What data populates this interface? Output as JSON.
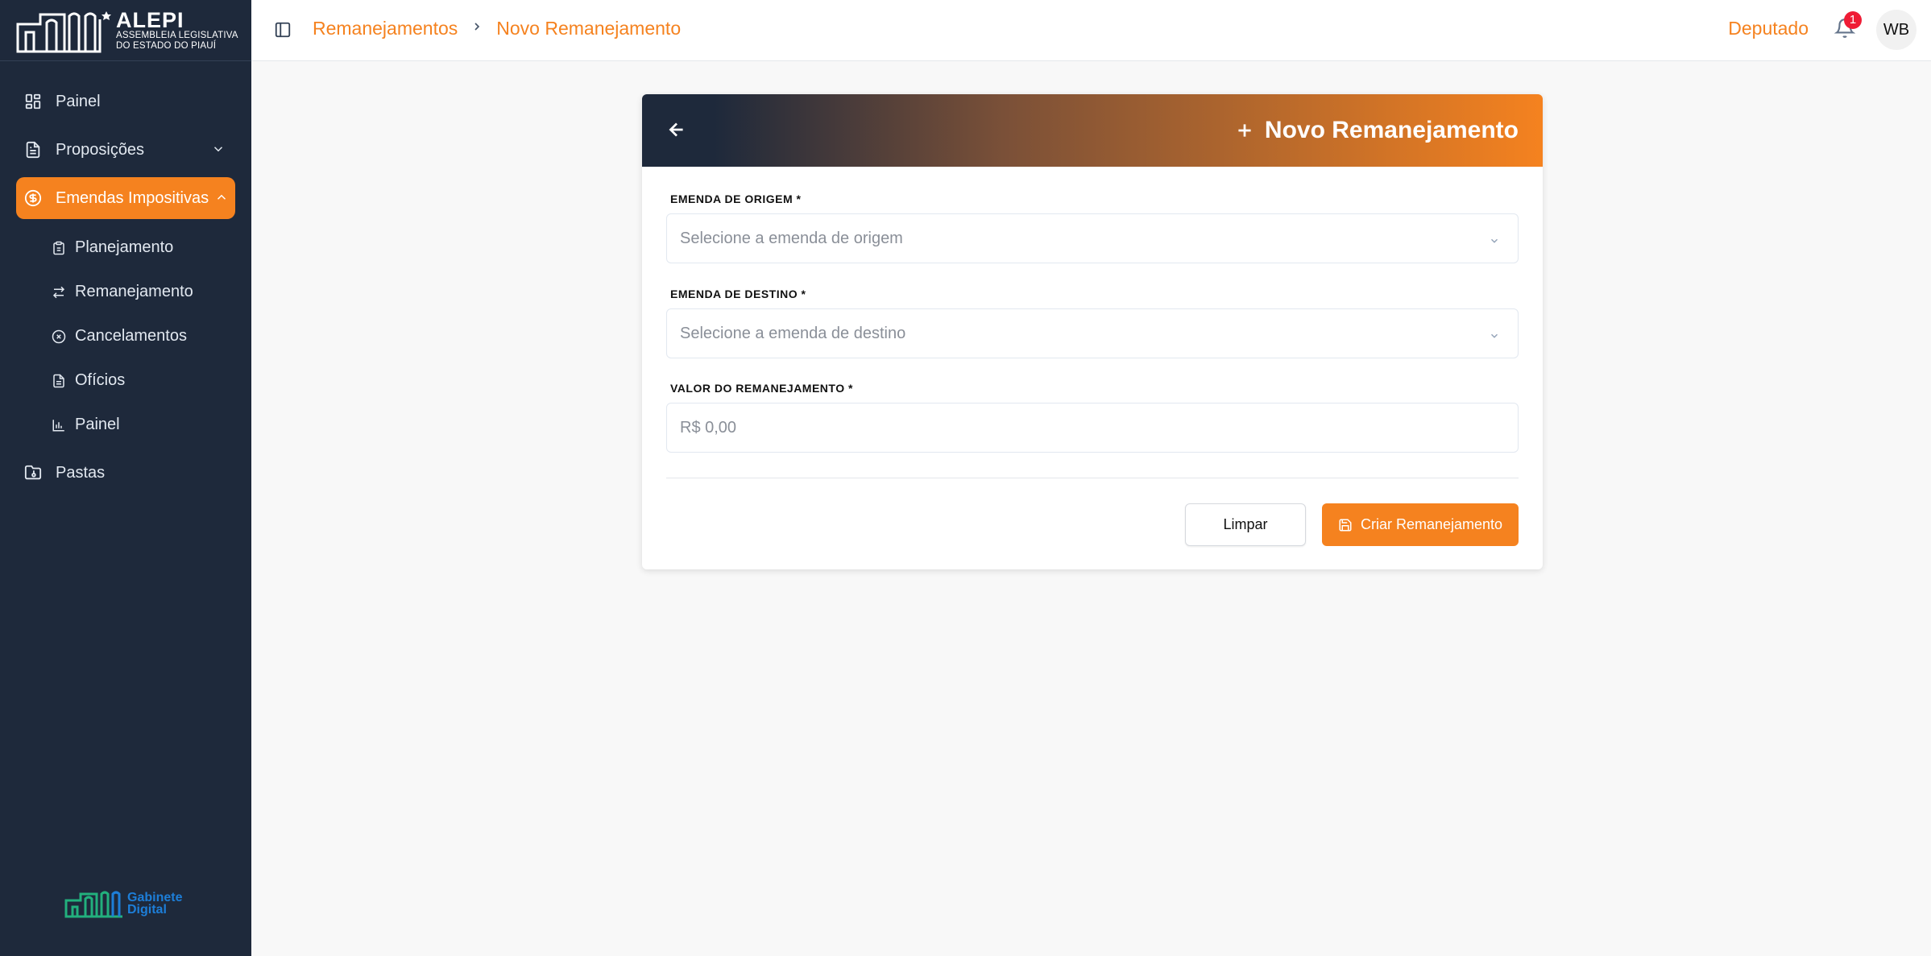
{
  "brand": {
    "name": "ALEPI",
    "subtitle_line1": "ASSEMBLEIA LEGISLATIVA",
    "subtitle_line2": "DO ESTADO DO PIAUÍ",
    "footer_line1": "Gabinete",
    "footer_line2": "Digital",
    "accent_color": "#f5821f",
    "sidebar_color": "#1e293b"
  },
  "sidebar": {
    "items": [
      {
        "label": "Painel",
        "icon": "dashboard-icon"
      },
      {
        "label": "Proposições",
        "icon": "document-icon"
      },
      {
        "label": "Emendas Impositivas",
        "icon": "dollar-icon"
      },
      {
        "label": "Pastas",
        "icon": "folder-icon"
      }
    ],
    "subitems": [
      {
        "label": "Planejamento",
        "icon": "clipboard-icon"
      },
      {
        "label": "Remanejamento",
        "icon": "swap-icon"
      },
      {
        "label": "Cancelamentos",
        "icon": "cancel-circle-icon"
      },
      {
        "label": "Ofícios",
        "icon": "file-icon"
      },
      {
        "label": "Painel",
        "icon": "bar-chart-icon"
      }
    ]
  },
  "header": {
    "breadcrumb": [
      "Remanejamentos",
      "Novo Remanejamento"
    ],
    "role": "Deputado",
    "notification_count": "1",
    "avatar_initials": "WB"
  },
  "form": {
    "title": "Novo Remanejamento",
    "origin_label": "EMENDA DE ORIGEM *",
    "origin_placeholder": "Selecione a emenda de origem",
    "destination_label": "EMENDA DE DESTINO *",
    "destination_placeholder": "Selecione a emenda de destino",
    "value_label": "VALOR DO REMANEJAMENTO *",
    "value_placeholder": "R$ 0,00",
    "clear_label": "Limpar",
    "submit_label": "Criar Remanejamento"
  }
}
